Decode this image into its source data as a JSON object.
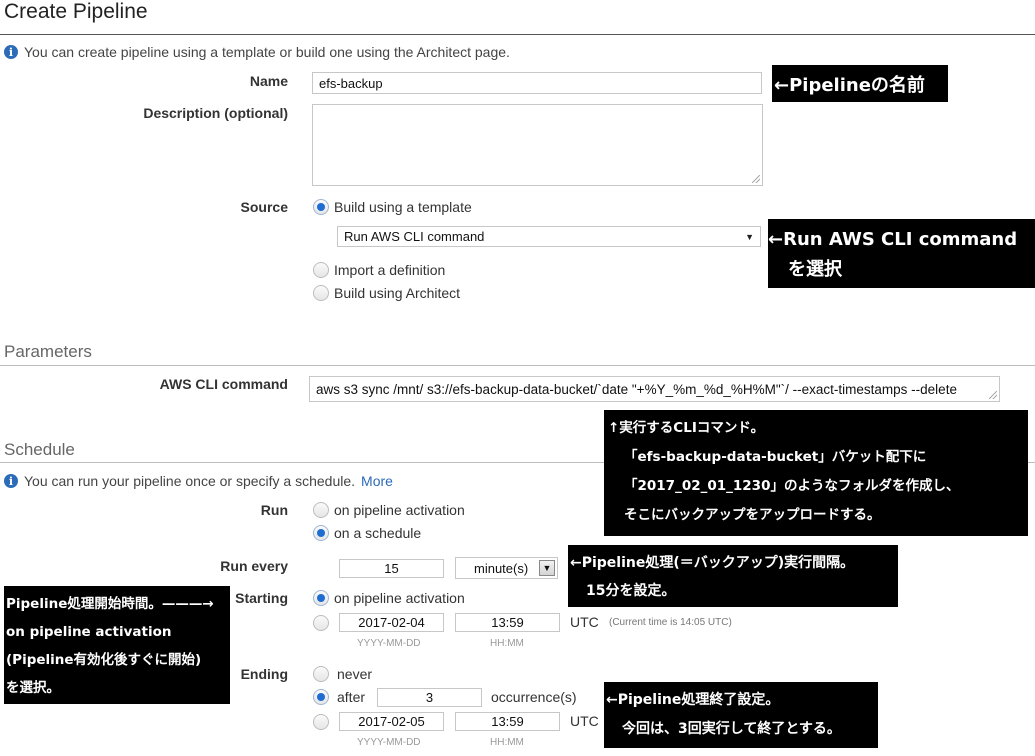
{
  "page": {
    "title": "Create Pipeline",
    "intro": "You can create pipeline using a template or build one using the Architect page."
  },
  "form": {
    "name_label": "Name",
    "name_value": "efs-backup",
    "description_label": "Description (optional)",
    "description_value": "",
    "source_label": "Source",
    "source_options": {
      "template": "Build using a template",
      "import": "Import a definition",
      "architect": "Build using Architect"
    },
    "source_selected": "template",
    "template_select_value": "Run AWS CLI command"
  },
  "parameters": {
    "heading": "Parameters",
    "cli_label": "AWS CLI command",
    "cli_value": "aws s3 sync /mnt/ s3://efs-backup-data-bucket/`date \"+%Y_%m_%d_%H%M\"`/ --exact-timestamps --delete"
  },
  "schedule": {
    "heading": "Schedule",
    "info": "You can run your pipeline once or specify a schedule.",
    "more_link": "More",
    "run_label": "Run",
    "run_options": {
      "activation": "on pipeline activation",
      "schedule": "on a schedule"
    },
    "run_selected": "schedule",
    "run_every_label": "Run every",
    "run_every_value": "15",
    "run_every_unit": "minute(s)",
    "starting_label": "Starting",
    "starting_option": "on pipeline activation",
    "starting_selected": "activation",
    "start_date": "2017-02-04",
    "start_time": "13:59",
    "utc": "UTC",
    "current_time": "(Current time is 14:05 UTC)",
    "date_hint": "YYYY-MM-DD",
    "time_hint": "HH:MM",
    "ending_label": "Ending",
    "ending_never": "never",
    "ending_after": "after",
    "ending_after_count": "3",
    "ending_occurrences": "occurrence(s)",
    "ending_selected": "after",
    "end_date": "2017-02-05",
    "end_time": "13:59"
  },
  "callouts": {
    "name": "←Pipelineの名前",
    "template_line1": "←Run AWS CLI command",
    "template_line2": "を選択",
    "cli_line1": "↑実行するCLIコマンド。",
    "cli_line2": "「efs-backup-data-bucket」バケット配下に",
    "cli_line3": "「2017_02_01_1230」のようなフォルダを作成し、",
    "cli_line4": "そこにバックアップをアップロードする。",
    "interval_line1": "←Pipeline処理(＝バックアップ)実行間隔。",
    "interval_line2": "15分を設定。",
    "start_line1": "Pipeline処理開始時間。———→",
    "start_line2": "on pipeline activation",
    "start_line3": "(Pipeline有効化後すぐに開始)",
    "start_line4": "を選択。",
    "end_line1": "←Pipeline処理終了設定。",
    "end_line2": "今回は、3回実行して終了とする。"
  }
}
